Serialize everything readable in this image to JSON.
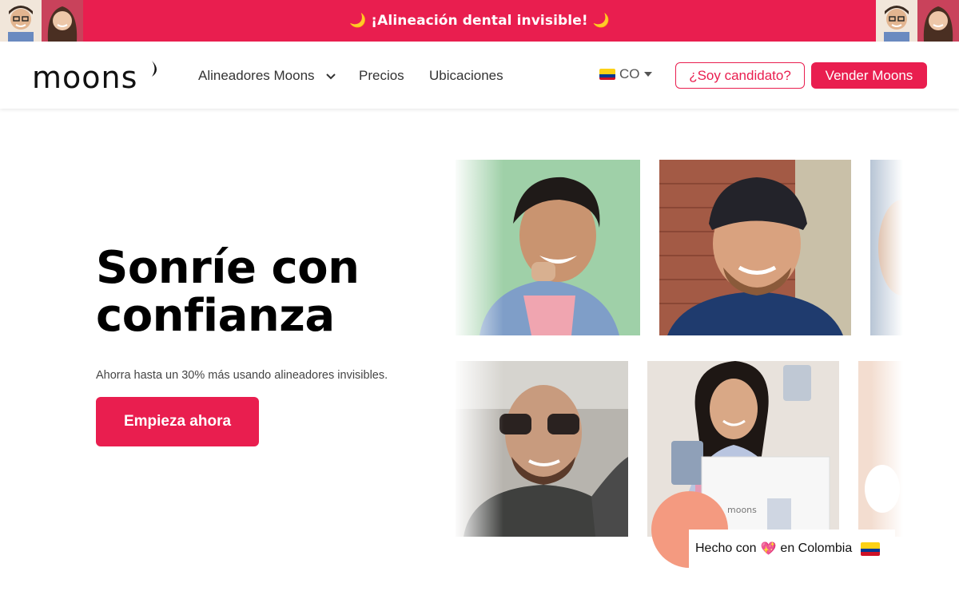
{
  "promo": {
    "text": "🌙 ¡Alineación dental invisible! 🌙"
  },
  "header": {
    "logo_text": "moons",
    "nav": [
      {
        "label": "Alineadores Moons",
        "has_dropdown": true
      },
      {
        "label": "Precios"
      },
      {
        "label": "Ubicaciones"
      }
    ],
    "country": "CO",
    "candidate_button": "¿Soy candidato?",
    "sell_button": "Vender Moons"
  },
  "hero": {
    "title": "Sonríe con confianza",
    "subtitle": "Ahorra hasta un 30% más usando alineadores invisibles.",
    "cta": "Empieza ahora"
  },
  "badge": {
    "prefix": "Hecho con",
    "heart": "💖",
    "suffix": "en Colombia"
  },
  "colors": {
    "brand": "#e91e4f",
    "badge_circle": "#f49a80"
  }
}
